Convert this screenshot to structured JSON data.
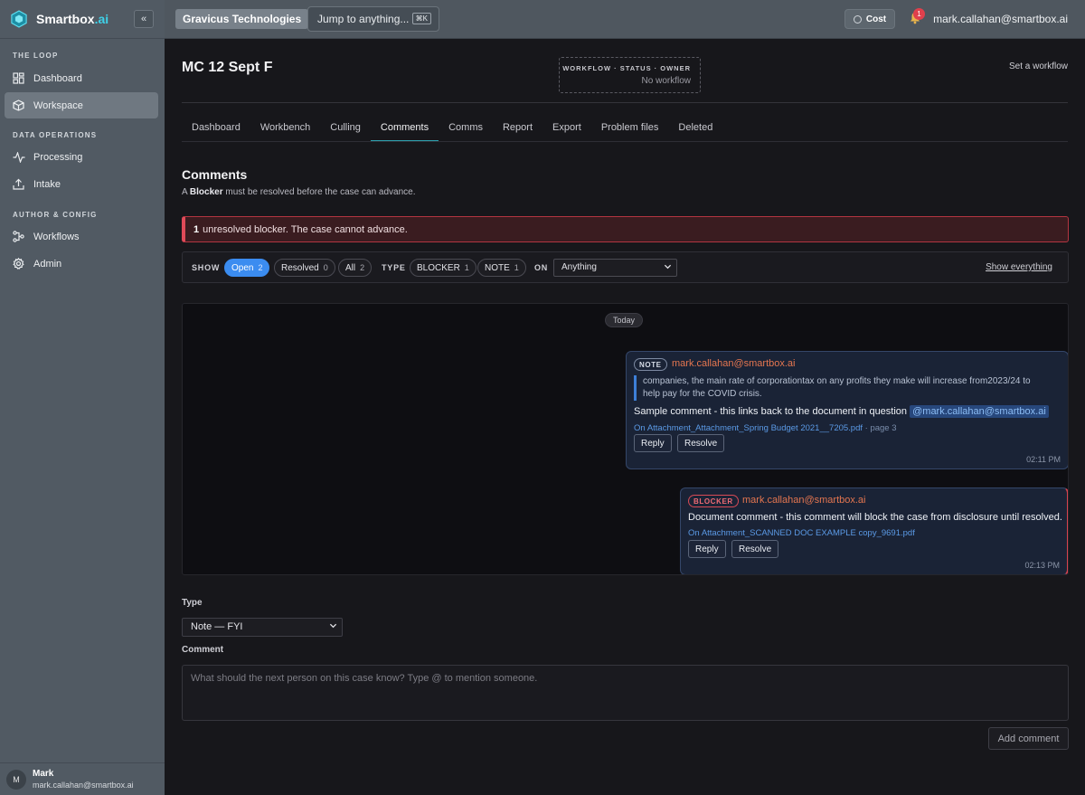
{
  "brand": {
    "name": "Smartbox",
    "suffix": ".ai",
    "accent": "#3fd1e8",
    "collapse": "«"
  },
  "sidebar": {
    "sections": [
      {
        "label": "THE LOOP",
        "items": [
          {
            "label": "Dashboard",
            "icon": "grid-icon"
          },
          {
            "label": "Workspace",
            "icon": "cube-icon",
            "active": true
          }
        ]
      },
      {
        "label": "DATA OPERATIONS",
        "items": [
          {
            "label": "Processing",
            "icon": "activity-icon"
          },
          {
            "label": "Intake",
            "icon": "upload-icon"
          }
        ]
      },
      {
        "label": "AUTHOR & CONFIG",
        "items": [
          {
            "label": "Workflows",
            "icon": "workflow-icon"
          },
          {
            "label": "Admin",
            "icon": "gear-icon"
          }
        ]
      }
    ],
    "user": {
      "initial": "M",
      "name": "Mark",
      "email": "mark.callahan@smartbox.ai"
    }
  },
  "topbar": {
    "org": "Gravicus Technologies",
    "jump": "Jump to anything...",
    "shortcut": "⌘K",
    "cost": "Cost",
    "notifications": "1",
    "user_email": "mark.callahan@smartbox.ai"
  },
  "page": {
    "title": "MC 12 Sept F",
    "workflow_label": "WORKFLOW · STATUS · OWNER",
    "workflow_value": "No workflow",
    "set_workflow": "Set a workflow"
  },
  "tabs": [
    "Dashboard",
    "Workbench",
    "Culling",
    "Comments",
    "Comms",
    "Report",
    "Export",
    "Problem files",
    "Deleted"
  ],
  "active_tab": "Comments",
  "comments_section": {
    "title": "Comments",
    "sub_prefix": "A",
    "sub_bold": "Blocker",
    "sub_suffix": "must be resolved before the case can advance.",
    "alert_count": "1",
    "alert_text": "unresolved blocker. The case cannot advance.",
    "alert_color": "#e04a58"
  },
  "filters": {
    "show_label": "SHOW",
    "show": [
      {
        "label": "Open",
        "count": "2",
        "active": true
      },
      {
        "label": "Resolved",
        "count": "0"
      },
      {
        "label": "All",
        "count": "2"
      }
    ],
    "type_label": "TYPE",
    "types": [
      {
        "label": "BLOCKER",
        "count": "1"
      },
      {
        "label": "NOTE",
        "count": "1"
      }
    ],
    "on_label": "ON",
    "on_value": "Anything",
    "show_everything": "Show everything"
  },
  "thread": {
    "day": "Today",
    "comments": [
      {
        "tag": "NOTE",
        "author": "mark.callahan@smartbox.ai",
        "quote": "companies, the main rate of corporationtax on any profits they make will increase from2023/24 to help pay for the COVID crisis.",
        "text": "Sample comment - this links back to the document in question",
        "mention": "@mark.callahan@smartbox.ai",
        "link_prefix": "On",
        "link": "Attachment_Attachment_Spring Budget 2021__7205.pdf",
        "link_suffix": "· page 3",
        "reply": "Reply",
        "resolve": "Resolve",
        "time": "02:11 PM"
      },
      {
        "tag": "BLOCKER",
        "author": "mark.callahan@smartbox.ai",
        "text": "Document comment - this comment will block the case from disclosure until resolved.",
        "link_prefix": "On",
        "link": "Attachment_SCANNED DOC EXAMPLE copy_9691.pdf",
        "reply": "Reply",
        "resolve": "Resolve",
        "time": "02:13 PM"
      }
    ]
  },
  "composer": {
    "type_label": "Type",
    "type_value": "Note — FYI",
    "comment_label": "Comment",
    "placeholder": "What should the next person on this case know? Type @ to mention someone.",
    "add": "Add comment"
  }
}
